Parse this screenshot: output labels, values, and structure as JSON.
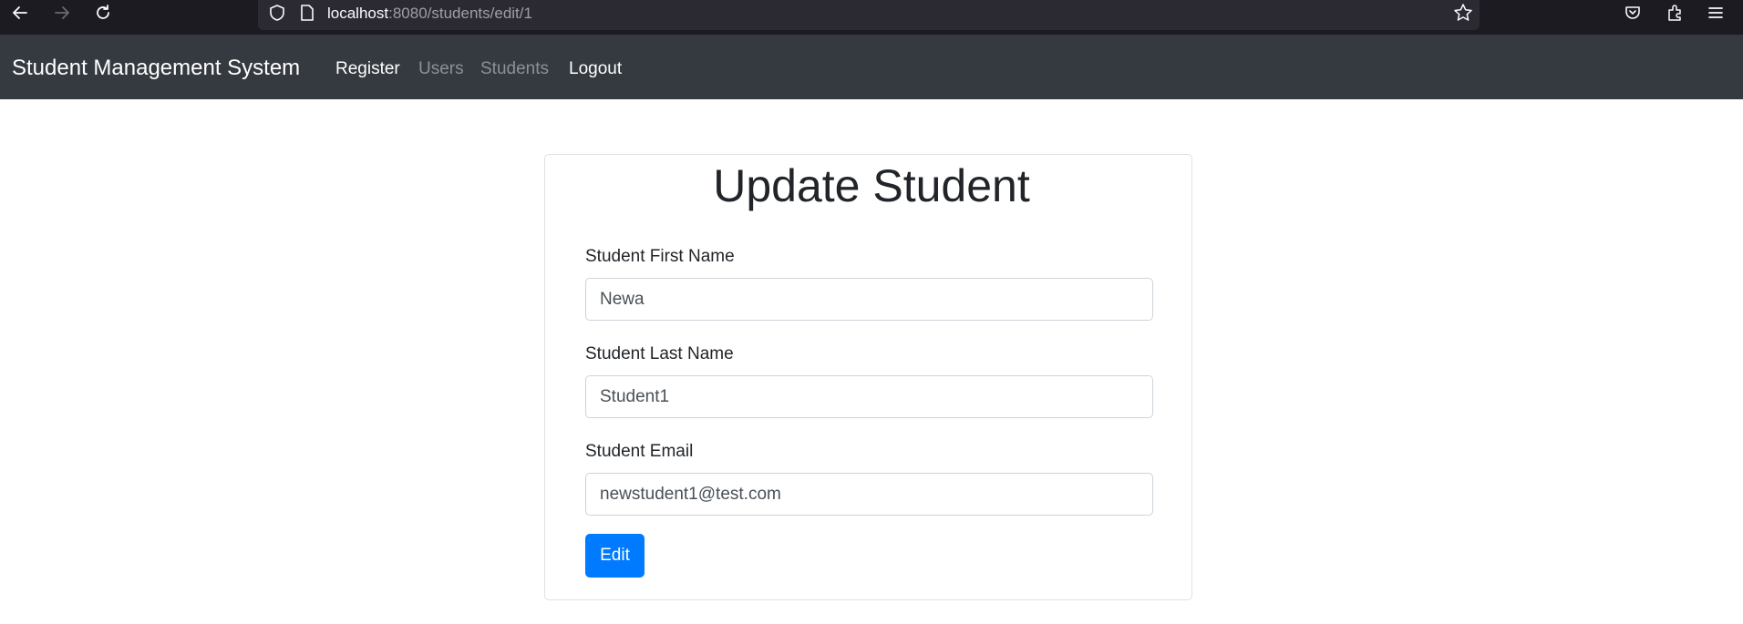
{
  "browser": {
    "url_host": "localhost",
    "url_path": ":8080/students/edit/1",
    "icons": [
      "back-arrow-icon",
      "forward-arrow-icon",
      "reload-icon",
      "shield-icon",
      "page-icon",
      "bookmark-star-icon",
      "pocket-icon",
      "extensions-icon",
      "menu-icon"
    ]
  },
  "navbar": {
    "brand": "Student Management System",
    "links": [
      {
        "label": "Register",
        "active": true
      },
      {
        "label": "Users",
        "active": false
      },
      {
        "label": "Students",
        "active": false
      },
      {
        "label": "Logout",
        "active": true
      }
    ]
  },
  "form": {
    "title": "Update Student",
    "fields": [
      {
        "label": "Student First Name",
        "value": "Newa"
      },
      {
        "label": "Student Last Name",
        "value": "Student1"
      },
      {
        "label": "Student Email",
        "value": "newstudent1@test.com"
      }
    ],
    "submit_label": "Edit"
  },
  "colors": {
    "navbar_bg": "#343a40",
    "primary": "#007bff",
    "browser_bg": "#1c1b22"
  }
}
